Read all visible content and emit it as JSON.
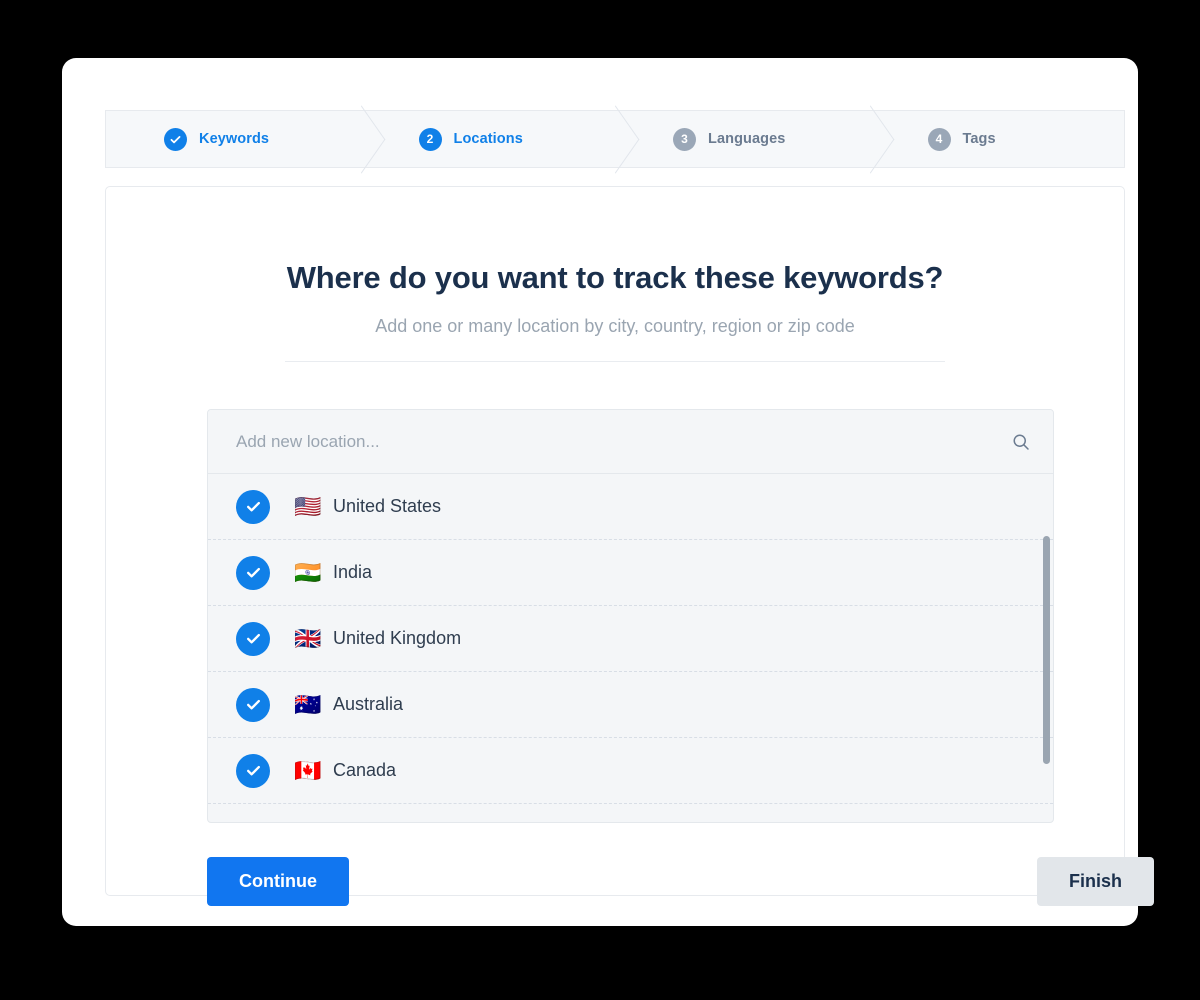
{
  "stepper": {
    "steps": [
      {
        "badge": "check-icon",
        "number": "",
        "label": "Keywords",
        "state": "done"
      },
      {
        "badge": "number",
        "number": "2",
        "label": "Locations",
        "state": "active"
      },
      {
        "badge": "number",
        "number": "3",
        "label": "Languages",
        "state": "todo"
      },
      {
        "badge": "number",
        "number": "4",
        "label": "Tags",
        "state": "todo"
      }
    ]
  },
  "panel": {
    "heading": "Where do you want to track these keywords?",
    "subtitle": "Add one or many location by city, country, region or zip code"
  },
  "picker": {
    "search": {
      "placeholder": "Add new location...",
      "value": "",
      "icon": "search-icon"
    },
    "locations": [
      {
        "name": "United States",
        "flag": "🇺🇸",
        "selected": true
      },
      {
        "name": "India",
        "flag": "🇮🇳",
        "selected": true
      },
      {
        "name": "United Kingdom",
        "flag": "🇬🇧",
        "selected": true
      },
      {
        "name": "Australia",
        "flag": "🇦🇺",
        "selected": true
      },
      {
        "name": "Canada",
        "flag": "🇨🇦",
        "selected": true
      }
    ]
  },
  "footer": {
    "continue_label": "Continue",
    "finish_label": "Finish"
  },
  "colors": {
    "accent_blue": "#1080e8",
    "button_blue": "#1176f0",
    "heading_navy": "#1b304c",
    "muted_gray": "#9aa5b1",
    "step_todo_gray": "#9aa7b7",
    "panel_bg": "#f4f6f8"
  }
}
